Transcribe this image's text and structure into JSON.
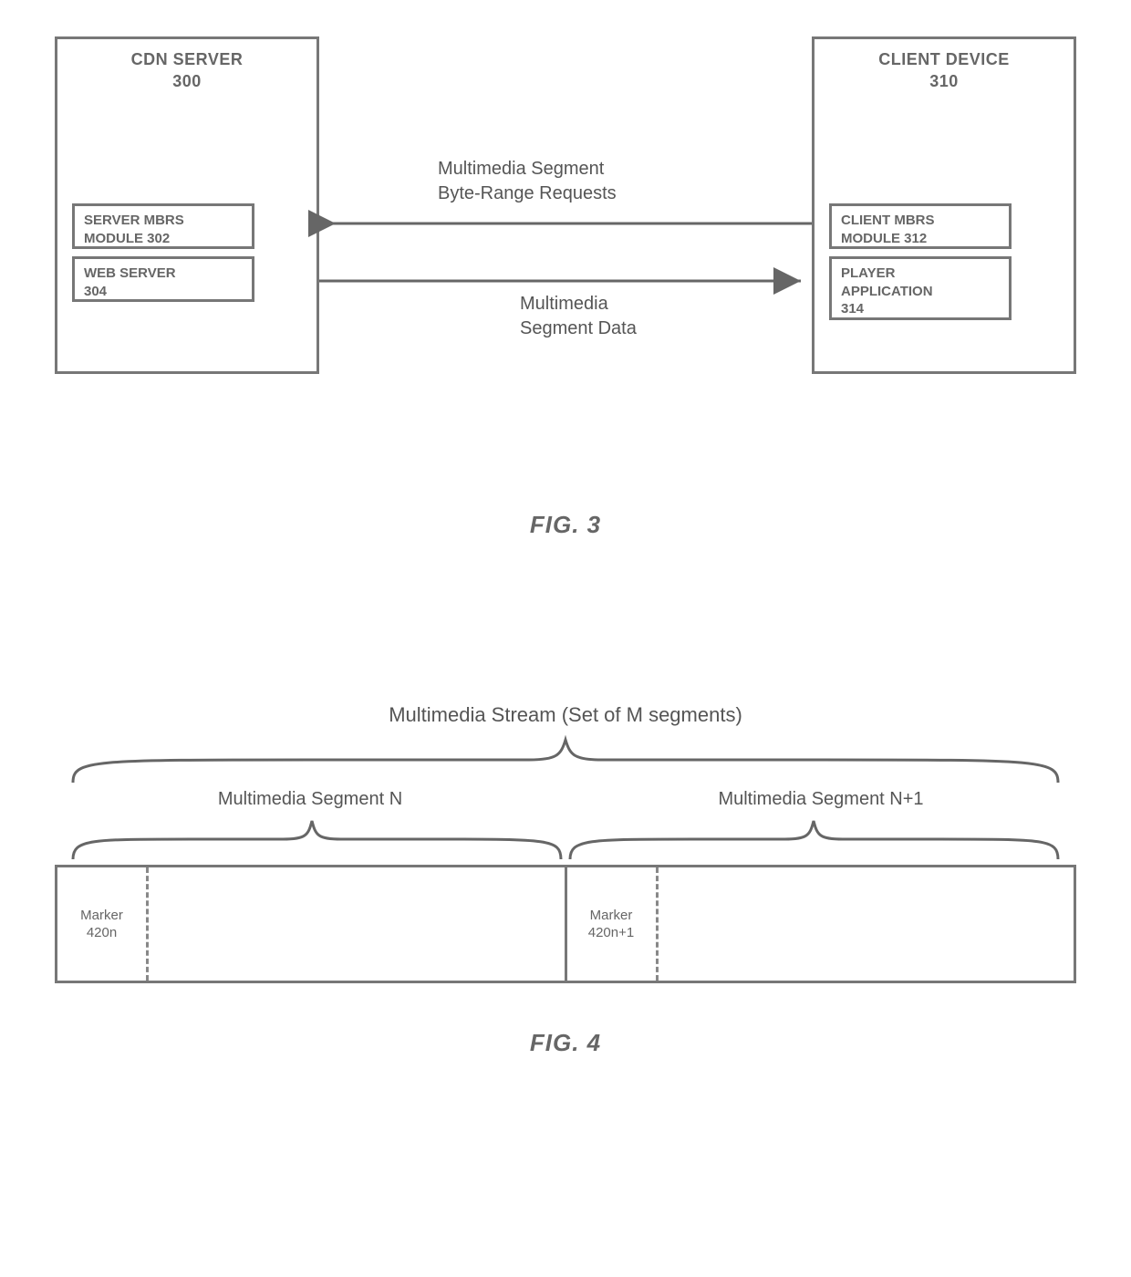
{
  "fig3": {
    "server": {
      "title": "CDN SERVER",
      "num": "300",
      "mbrs": {
        "label": "SERVER MBRS",
        "sublabel": "MODULE",
        "num": "302"
      },
      "web": {
        "label": "WEB SERVER",
        "num": "304"
      }
    },
    "client": {
      "title": "CLIENT DEVICE",
      "num": "310",
      "mbrs": {
        "label": "CLIENT MBRS",
        "sublabel": "MODULE",
        "num": "312"
      },
      "player": {
        "label1": "PLAYER",
        "label2": "APPLICATION",
        "num": "314"
      }
    },
    "top_arrow": "Multimedia Segment\nByte-Range Requests",
    "bot_arrow": "Multimedia\nSegment Data",
    "caption": "FIG. 3"
  },
  "fig4": {
    "stream_title": "Multimedia Stream (Set of M segments)",
    "segN_label": "Multimedia Segment N",
    "segN1_label": "Multimedia Segment N+1",
    "markerN": {
      "label": "Marker",
      "num": "420n"
    },
    "markerN1": {
      "label": "Marker",
      "num": "420n+1"
    },
    "caption": "FIG. 4"
  }
}
